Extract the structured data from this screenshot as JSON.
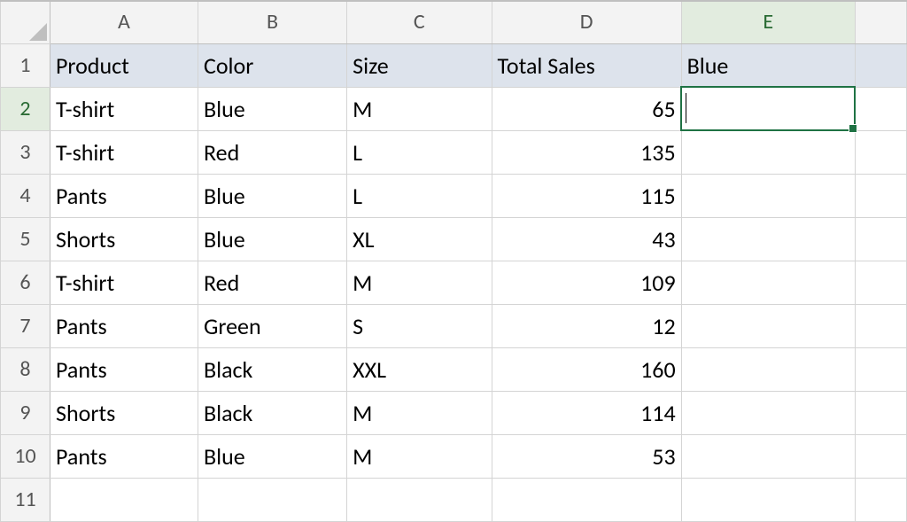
{
  "chart_data": {
    "type": "table",
    "columns": [
      "Product",
      "Color",
      "Size",
      "Total Sales"
    ],
    "rows": [
      [
        "T-shirt",
        "Blue",
        "M",
        65
      ],
      [
        "T-shirt",
        "Red",
        "L",
        135
      ],
      [
        "Pants",
        "Blue",
        "L",
        115
      ],
      [
        "Shorts",
        "Blue",
        "XL",
        43
      ],
      [
        "T-shirt",
        "Red",
        "M",
        109
      ],
      [
        "Pants",
        "Green",
        "S",
        12
      ],
      [
        "Pants",
        "Black",
        "XXL",
        160
      ],
      [
        "Shorts",
        "Black",
        "M",
        114
      ],
      [
        "Pants",
        "Blue",
        "M",
        53
      ]
    ],
    "extra_header_E1": "Blue"
  },
  "grid": {
    "col_letters": [
      "A",
      "B",
      "C",
      "D",
      "E"
    ],
    "row_numbers": [
      "1",
      "2",
      "3",
      "4",
      "5",
      "6",
      "7",
      "8",
      "9",
      "10",
      "11"
    ],
    "active_cell": "E2"
  },
  "header": {
    "A": "Product",
    "B": "Color",
    "C": "Size",
    "D": "Total Sales",
    "E": "Blue"
  },
  "rows": {
    "r2": {
      "A": "T-shirt",
      "B": "Blue",
      "C": "M",
      "D": "65"
    },
    "r3": {
      "A": "T-shirt",
      "B": "Red",
      "C": "L",
      "D": "135"
    },
    "r4": {
      "A": "Pants",
      "B": "Blue",
      "C": "L",
      "D": "115"
    },
    "r5": {
      "A": "Shorts",
      "B": "Blue",
      "C": "XL",
      "D": "43"
    },
    "r6": {
      "A": "T-shirt",
      "B": "Red",
      "C": "M",
      "D": "109"
    },
    "r7": {
      "A": "Pants",
      "B": "Green",
      "C": "S",
      "D": "12"
    },
    "r8": {
      "A": "Pants",
      "B": "Black",
      "C": "XXL",
      "D": "160"
    },
    "r9": {
      "A": "Shorts",
      "B": "Black",
      "C": "M",
      "D": "114"
    },
    "r10": {
      "A": "Pants",
      "B": "Blue",
      "C": "M",
      "D": "53"
    }
  }
}
